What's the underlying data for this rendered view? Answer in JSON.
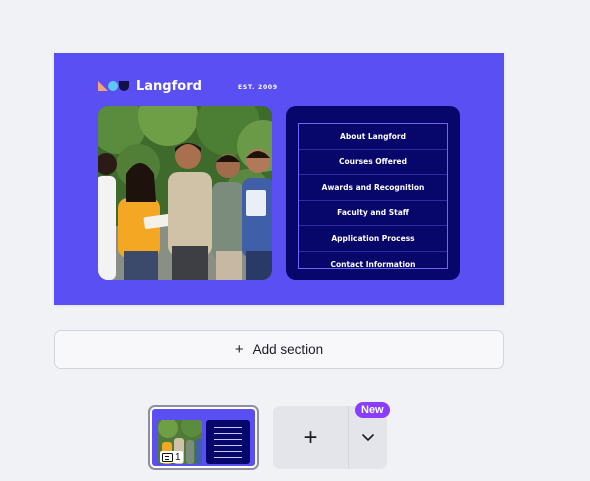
{
  "canvas": {
    "brand": "Langford",
    "est": "EST. 2009",
    "menu_items": [
      "About Langford",
      "Courses Offered",
      "Awards and Recognition",
      "Faculty and Staff",
      "Application Process",
      "Contact Information"
    ],
    "colors": {
      "background": "#5a4ff3",
      "menu_card": "#07066b",
      "frame": "#6e66ff"
    }
  },
  "add_section": {
    "label": "Add section"
  },
  "pages": {
    "thumbnail_page_number": "1",
    "new_badge": "New"
  },
  "colors": {
    "accent": "#8b3dff",
    "page_bg": "#f1f2f6"
  }
}
